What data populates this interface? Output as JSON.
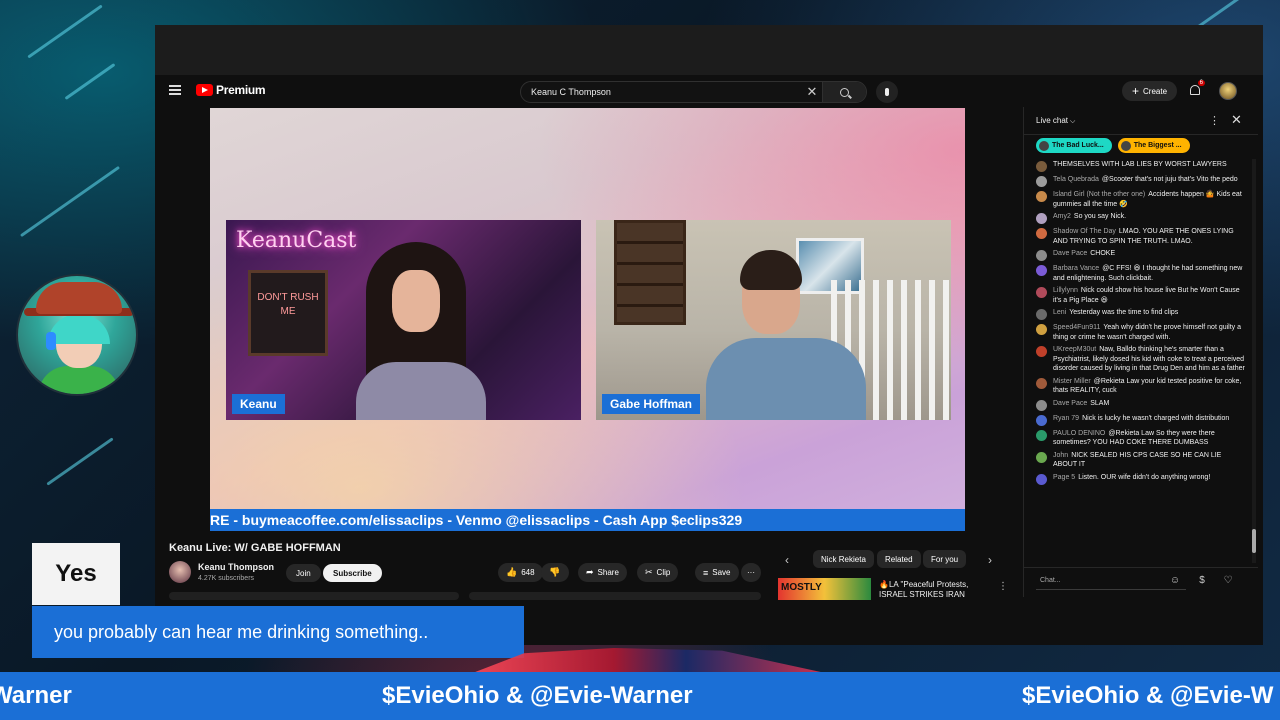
{
  "youtube": {
    "brand": "Premium",
    "search": {
      "value": "Keanu C Thompson"
    },
    "create_label": "Create",
    "notification_count": "6"
  },
  "video": {
    "left_cam_sign": "KeanuCast",
    "left_cam_poster": "DON'T RUSH ME",
    "left_name": "Keanu",
    "right_name": "Gabe Hoffman",
    "ticker": "RE - buymeacoffee.com/elissaclips - Venmo @elissaclips - Cash App $eclips329",
    "title": "Keanu Live: W/ GABE HOFFMAN",
    "channel": "Keanu Thompson",
    "subscribers": "4.27K subscribers",
    "join_label": "Join",
    "subscribe_label": "Subscribe",
    "like_count": "648",
    "share_label": "Share",
    "clip_label": "Clip",
    "save_label": "Save",
    "more_label": "···"
  },
  "chips": [
    "Nick Rekieta",
    "Related",
    "For you"
  ],
  "recommendation": {
    "thumb_text": "MOSTLY",
    "line1": "🔥LA \"Peaceful Protests,",
    "line2": "ISRAEL STRIKES IRAN"
  },
  "chat": {
    "title": "Live chat",
    "tags": [
      "The Bad Luck...",
      "The Biggest ..."
    ],
    "input_placeholder": "Chat...",
    "messages": [
      {
        "author": "",
        "text": "THEMSELVES WITH LAB LIES BY WORST LAWYERS",
        "color": "#7a5c3c"
      },
      {
        "author": "Tela Quebrada",
        "text": "@Scooter that's not juju that's Vito the pedo",
        "color": "#9c9c9c"
      },
      {
        "author": "Island Girl (Not the other one)",
        "text": "Accidents happen 🤷 Kids eat gummies all the time 🤣",
        "color": "#c88a4a"
      },
      {
        "author": "Amy2",
        "text": "So you say Nick.",
        "color": "#b0a0c0"
      },
      {
        "author": "Shadow Of The Day",
        "text": "LMAO. YOU ARE THE ONES LYING AND TRYING TO SPIN THE TRUTH. LMAO.",
        "color": "#d06a40"
      },
      {
        "author": "Dave Pace",
        "text": "CHOKE",
        "color": "#8c8c8c"
      },
      {
        "author": "Barbara Vance",
        "text": "@C FFS! 😆 I thought he had something new and enlightening. Such clickbait.",
        "color": "#7b5bd6"
      },
      {
        "author": "Lillylynn",
        "text": "Nick could show his house live But he Won't Cause it's a Pig Place 😆",
        "color": "#b04a5a"
      },
      {
        "author": "Leni",
        "text": "Yesterday was the time to find clips",
        "color": "#6a6a6a"
      },
      {
        "author": "Speed4Fun911",
        "text": "Yeah why didn't he prove himself not guilty a thing or crime he wasn't charged with.",
        "color": "#d0a040"
      },
      {
        "author": "UKreepM30ut",
        "text": "Naw, Balldo thinking he's smarter than a Psychiatrist, likely dosed his kid with coke to treat a perceived disorder caused by living in that Drug Den and him as a father",
        "color": "#c0402a"
      },
      {
        "author": "Mister Miller",
        "text": "@Rekieta Law your kid tested positive for coke, thats REALITY, cuck",
        "color": "#a05a3a"
      },
      {
        "author": "Dave Pace",
        "text": "SLAM",
        "color": "#8c8c8c"
      },
      {
        "author": "Ryan 79",
        "text": "Nick is lucky he wasn't charged with distribution",
        "color": "#4a6ad0"
      },
      {
        "author": "PAULO DENINO",
        "text": "@Rekieta Law So they were there sometimes? YOU HAD COKE THERE DUMBASS",
        "color": "#2a9a6a"
      },
      {
        "author": "John",
        "text": "NICK SEALED HIS CPS CASE SO HE CAN LIE ABOUT IT",
        "color": "#6aa84f"
      },
      {
        "author": "Page 5",
        "text": "Listen. OUR wife didn't do anything wrong!",
        "color": "#5a5ad0"
      }
    ]
  },
  "overlay": {
    "yes": "Yes",
    "caption": "you probably can hear me drinking something..",
    "banner": [
      "Warner",
      "$EvieOhio & @Evie-Warner",
      "$EvieOhio & @Evie-W"
    ]
  },
  "colors": {
    "accent_blue": "#1b6fd6",
    "yt_red": "#ff0000",
    "tag_teal": "#1ed8c5",
    "tag_gold": "#ffb300"
  }
}
